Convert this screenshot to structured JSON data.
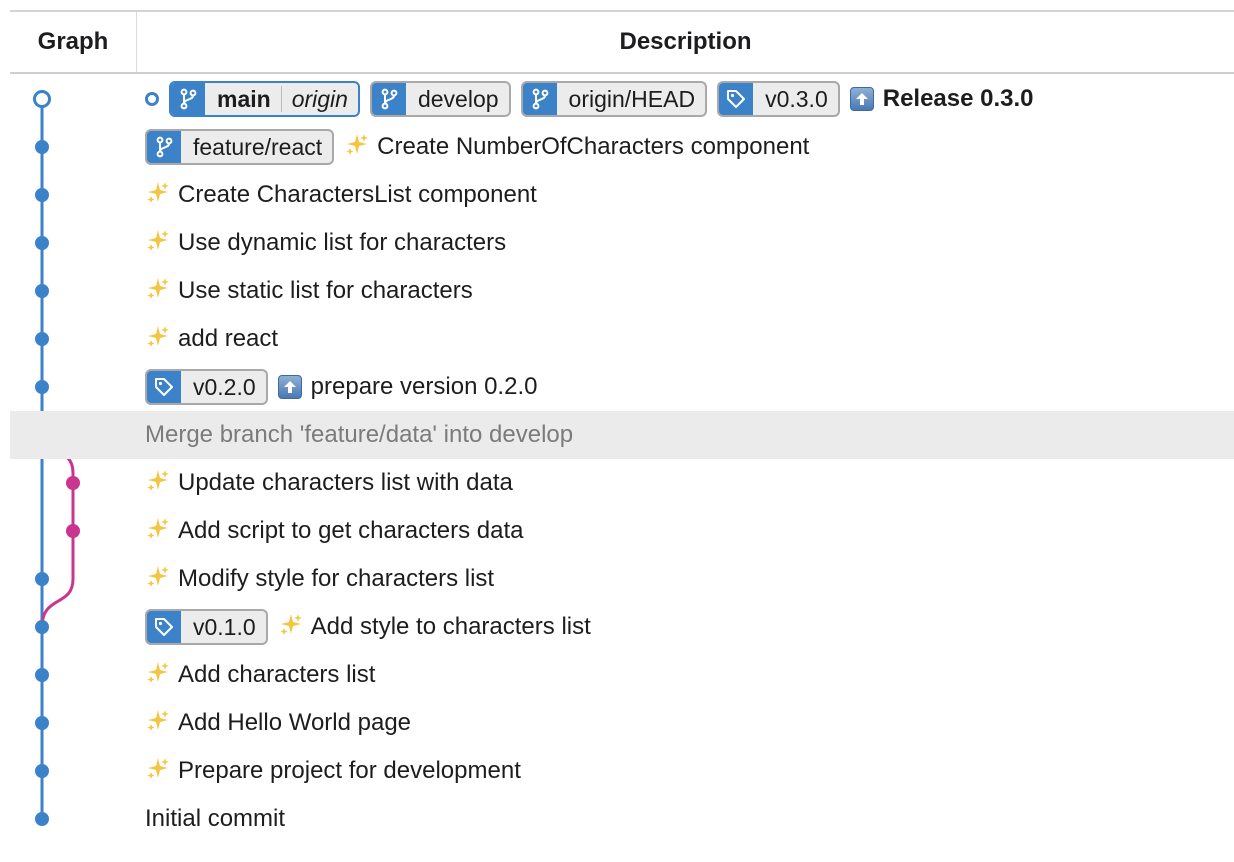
{
  "header": {
    "graph_label": "Graph",
    "description_label": "Description"
  },
  "colors": {
    "branch_main": "#3b82c8",
    "branch_feature": "#c9358f",
    "chip_icon_bg": "#3b82c8"
  },
  "commits": [
    {
      "refs": [
        {
          "kind": "branch",
          "name": "main",
          "remote": "origin",
          "current": true
        },
        {
          "kind": "branch",
          "name": "develop"
        },
        {
          "kind": "branch",
          "name": "origin/HEAD"
        },
        {
          "kind": "tag",
          "name": "v0.3.0"
        }
      ],
      "icon": "up-arrow-icon",
      "message": "Release 0.3.0"
    },
    {
      "refs": [
        {
          "kind": "branch",
          "name": "feature/react"
        }
      ],
      "icon": "sparkles-icon",
      "message": "Create NumberOfCharacters component"
    },
    {
      "refs": [],
      "icon": "sparkles-icon",
      "message": "Create CharactersList component"
    },
    {
      "refs": [],
      "icon": "sparkles-icon",
      "message": "Use dynamic list for characters"
    },
    {
      "refs": [],
      "icon": "sparkles-icon",
      "message": "Use static list for characters"
    },
    {
      "refs": [],
      "icon": "sparkles-icon",
      "message": "add react"
    },
    {
      "refs": [
        {
          "kind": "tag",
          "name": "v0.2.0"
        }
      ],
      "icon": "up-arrow-icon",
      "message": "prepare version 0.2.0"
    },
    {
      "refs": [],
      "icon": "",
      "message": "Merge branch 'feature/data' into develop",
      "selected": true,
      "merge": true
    },
    {
      "refs": [],
      "icon": "sparkles-icon",
      "message": "Update characters list with data"
    },
    {
      "refs": [],
      "icon": "sparkles-icon",
      "message": "Add script to get characters data"
    },
    {
      "refs": [],
      "icon": "sparkles-icon",
      "message": "Modify style for characters list"
    },
    {
      "refs": [
        {
          "kind": "tag",
          "name": "v0.1.0"
        }
      ],
      "icon": "sparkles-icon",
      "message": "Add style to characters list"
    },
    {
      "refs": [],
      "icon": "sparkles-icon",
      "message": "Add characters list"
    },
    {
      "refs": [],
      "icon": "sparkles-icon",
      "message": "Add Hello World page"
    },
    {
      "refs": [],
      "icon": "sparkles-icon",
      "message": "Prepare project for development"
    },
    {
      "refs": [],
      "icon": "",
      "message": "Initial commit"
    }
  ]
}
